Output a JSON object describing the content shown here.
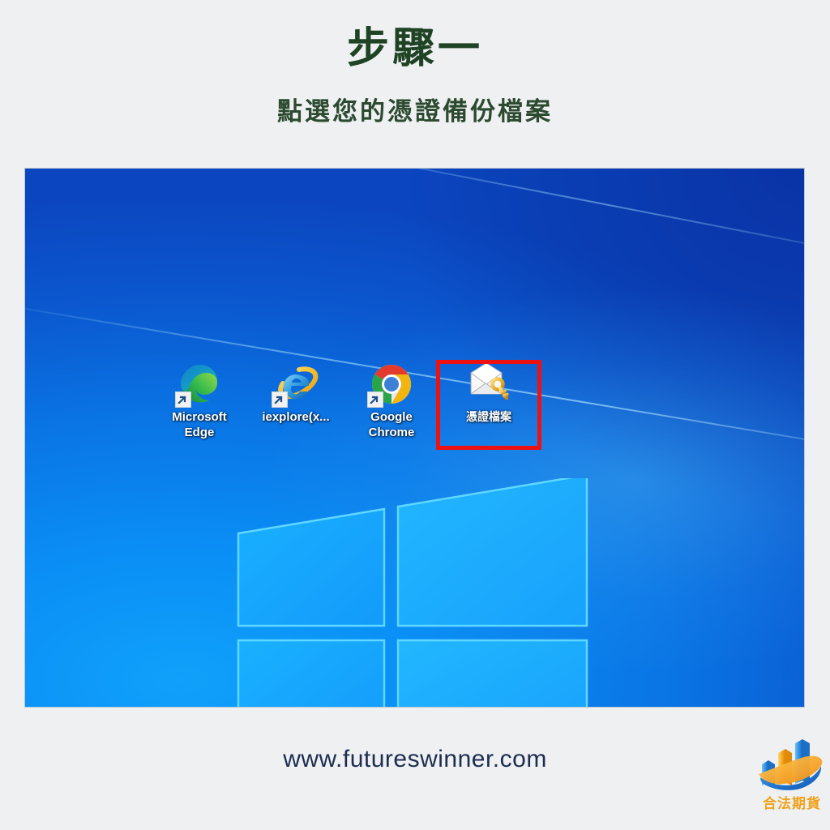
{
  "header": {
    "title": "步驟一",
    "subtitle": "點選您的憑證備份檔案",
    "title_color": "#1f4324",
    "subtitle_color": "#2c4a30"
  },
  "desktop": {
    "wallpaper_name": "windows-10-hero-wallpaper",
    "icons": [
      {
        "name": "microsoft-edge",
        "label": "Microsoft Edge",
        "icon": "edge-icon",
        "has_shortcut_badge": true
      },
      {
        "name": "internet-explorer",
        "label": "iexplore(x...",
        "icon": "internet-explorer-icon",
        "has_shortcut_badge": true
      },
      {
        "name": "google-chrome",
        "label": "Google Chrome",
        "icon": "chrome-icon",
        "has_shortcut_badge": true
      },
      {
        "name": "certificate-file",
        "label": "憑證檔案",
        "icon": "envelope-key-icon",
        "has_shortcut_badge": false
      }
    ],
    "highlight": {
      "target": "certificate-file",
      "color": "#ee1111",
      "border_width_px": 5
    }
  },
  "footer": {
    "url": "www.futureswinner.com",
    "url_color": "#1d2d50",
    "logo": {
      "name": "合法期貨",
      "icon": "bar-chart-swoosh-logo",
      "accent_orange": "#f0a21b",
      "accent_blue": "#1f7fe0"
    }
  }
}
